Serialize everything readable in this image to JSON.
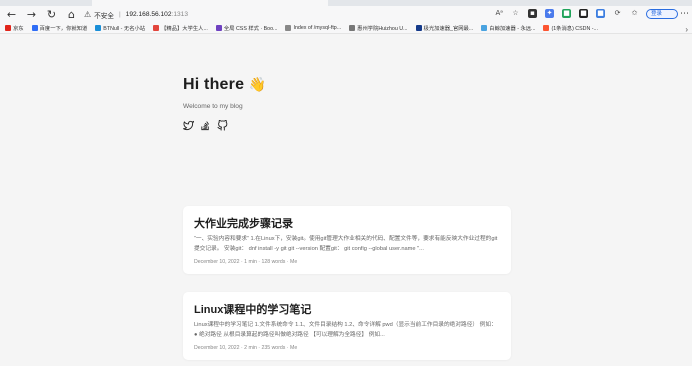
{
  "browser": {
    "address": {
      "insecure_label": "不安全",
      "separator": "|",
      "host": "192.168.56.102",
      "port": ":1313"
    },
    "login_label": "登录",
    "bookmarks": [
      {
        "label": "京东",
        "color": "#e1251b"
      },
      {
        "label": "百度一下，你就知道",
        "color": "#2f6df6"
      },
      {
        "label": "BTNull - 无名小站",
        "color": "#1a8fd8"
      },
      {
        "label": "【精品】大学生人...",
        "color": "#e2453c"
      },
      {
        "label": "全局 CSS 样式 · Boo...",
        "color": "#6f42c1"
      },
      {
        "label": "Index of /mysql-ftp...",
        "color": "#888888"
      },
      {
        "label": "惠州学院Huizhou U...",
        "color": "#777777"
      },
      {
        "label": "极光加速器_官网最...",
        "color": "#153a8a"
      },
      {
        "label": "白鲸加速器 - 永远...",
        "color": "#4aa3e0"
      },
      {
        "label": "(1条消息) CSDN -...",
        "color": "#fc5531"
      }
    ]
  },
  "profile": {
    "greeting": "Hi there",
    "wave": "👋",
    "subtitle": "Welcome to my blog"
  },
  "posts": [
    {
      "title": "大作业完成步骤记录",
      "excerpt": "“一、实验内容和要求” 1.在Linux下，安装git。使用git管理大作业相关的代码、配置文件等，要求有能反映大作业过程的git提交记录。 安装git： dnf install -y git git --version 配置git： git config --global user.name \"...",
      "meta": "December 10, 2022 · 1 min · 128 words · Me"
    },
    {
      "title": "Linux课程中的学习笔记",
      "excerpt": "Linux课程中的学习笔记 1.文件系统命令 1.1、文件目录结构 1.2、命令详解 pwd（显示当前工作目录的绝对路径） 例如： ● 绝对路径 从根目录算起的路径叫做绝对路径 【可以理解为全路径】 例如...",
      "meta": "December 10, 2022 · 2 min · 235 words · Me"
    }
  ]
}
